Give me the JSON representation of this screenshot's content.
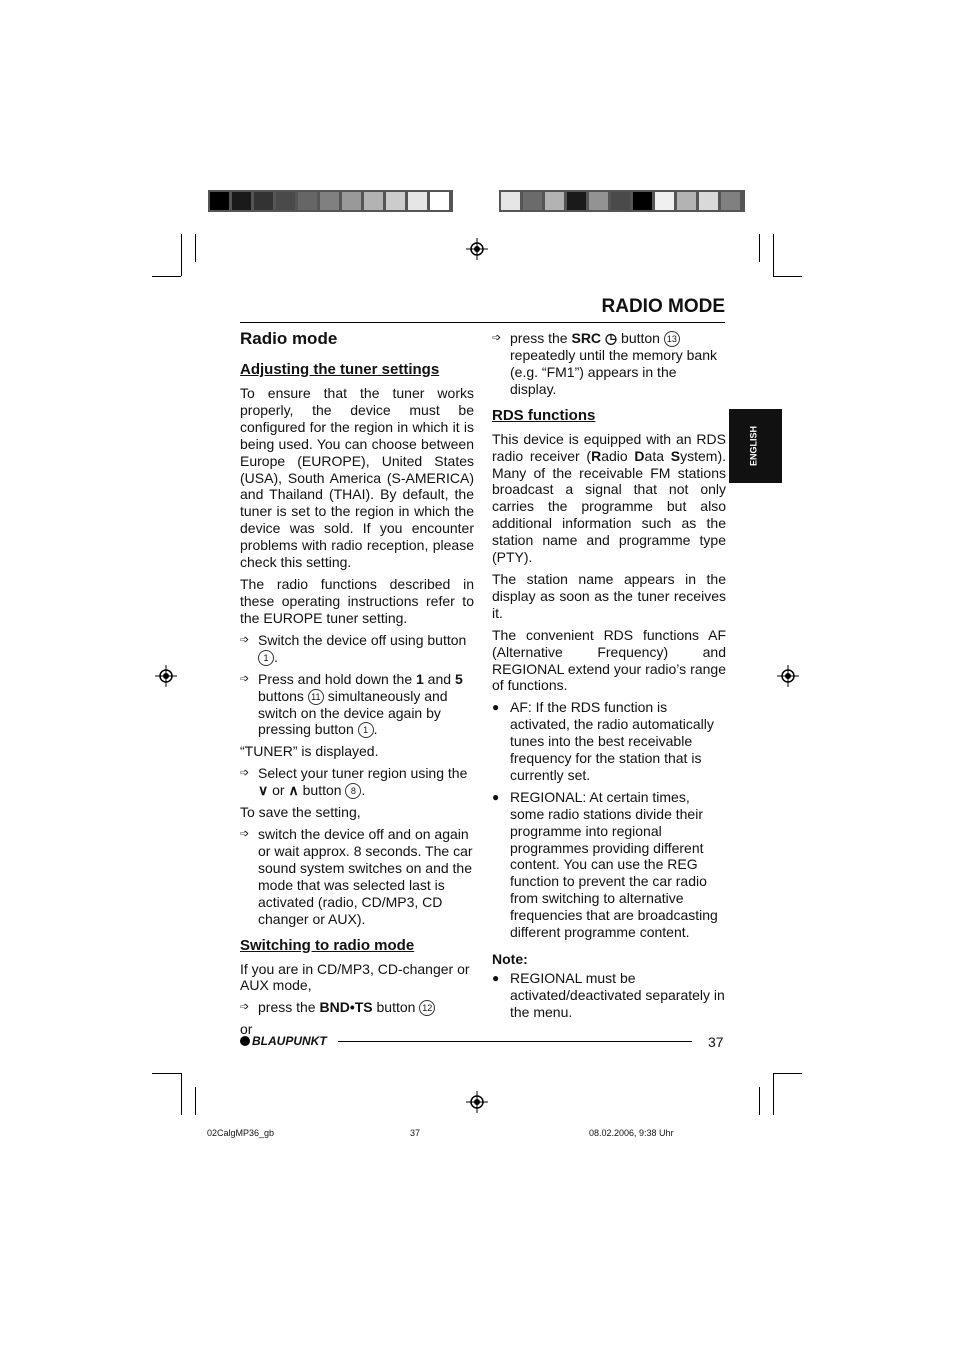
{
  "colors": {
    "bar_left": [
      "#000000",
      "#1a1a1a",
      "#333333",
      "#4a4a4a",
      "#666666",
      "#808080",
      "#999999",
      "#b3b3b3",
      "#cccccc",
      "#e6e6e6",
      "#ffffff"
    ],
    "bar_right": [
      "#e6e6e6",
      "#6b6b6b",
      "#b3b3b3",
      "#1a1a1a",
      "#939393",
      "#4a4a4a",
      "#000000",
      "#f0f0f0",
      "#b3b3b3",
      "#d9d9d9",
      "#808080"
    ]
  },
  "header": {
    "title": "RADIO MODE"
  },
  "side_tab": "ENGLISH",
  "left": [
    {
      "k": "h2",
      "s": [
        {
          "t": "Radio mode"
        }
      ]
    },
    {
      "k": "h3",
      "s": [
        {
          "t": "Adjusting the tuner settings"
        }
      ]
    },
    {
      "k": "p",
      "s": [
        {
          "t": "To ensure that the tuner works properly, the device must be configured for the region in which it is being used. You can choose between Europe (EUROPE), United States (USA), South America (S-AMERICA) and Thailand (THAI). By default, the tuner is set to the region in which the device was sold. If you encounter problems with radio reception, please check this setting."
        }
      ]
    },
    {
      "k": "p",
      "s": [
        {
          "t": "The radio functions described in these operating instructions refer to the EUROPE tuner setting."
        }
      ]
    },
    {
      "k": "arrow",
      "s": [
        {
          "t": "Switch the device off using button "
        },
        {
          "c": "1"
        },
        {
          "t": "."
        }
      ]
    },
    {
      "k": "arrow",
      "s": [
        {
          "t": "Press and hold down the "
        },
        {
          "b": "1"
        },
        {
          "t": " and "
        },
        {
          "b": "5"
        },
        {
          "t": " buttons "
        },
        {
          "c": "11"
        },
        {
          "t": " simultaneously and switch on the device again by pressing button "
        },
        {
          "c": "1"
        },
        {
          "t": "."
        }
      ]
    },
    {
      "k": "np",
      "s": [
        {
          "t": "“TUNER” is displayed."
        }
      ]
    },
    {
      "k": "arrow",
      "s": [
        {
          "t": "Select your tuner region using the "
        },
        {
          "b": "∨"
        },
        {
          "t": " or "
        },
        {
          "b": "∧"
        },
        {
          "t": " button "
        },
        {
          "c": "8"
        },
        {
          "t": "."
        }
      ]
    },
    {
      "k": "np",
      "s": [
        {
          "t": "To save the setting,"
        }
      ]
    },
    {
      "k": "arrow",
      "s": [
        {
          "t": "switch the device off and on again or wait approx. 8 seconds. The car sound system switches on and the mode that was selected last is activated (radio, CD/MP3, CD changer or AUX)."
        }
      ]
    },
    {
      "k": "h3",
      "s": [
        {
          "t": "Switching to radio mode"
        }
      ]
    },
    {
      "k": "np",
      "s": [
        {
          "t": "If you are in CD/MP3, CD-changer or AUX mode,"
        }
      ]
    },
    {
      "k": "arrow",
      "s": [
        {
          "t": "press the "
        },
        {
          "b": "BND•TS"
        },
        {
          "t": " button "
        },
        {
          "c": "12"
        }
      ]
    },
    {
      "k": "np",
      "s": [
        {
          "t": "or"
        }
      ]
    }
  ],
  "right": [
    {
      "k": "arrow",
      "s": [
        {
          "t": "press the "
        },
        {
          "b": "SRC ◷"
        },
        {
          "t": " button "
        },
        {
          "c": "13"
        },
        {
          "t": " repeatedly until the memory bank (e.g. “FM1”) appears in the display."
        }
      ]
    },
    {
      "k": "h3",
      "s": [
        {
          "t": "RDS functions"
        }
      ]
    },
    {
      "k": "p",
      "s": [
        {
          "t": "This device is equipped with an RDS radio receiver ("
        },
        {
          "b": "R"
        },
        {
          "t": "adio "
        },
        {
          "b": "D"
        },
        {
          "t": "ata "
        },
        {
          "b": "S"
        },
        {
          "t": "ystem). Many of the receivable FM stations broadcast a signal that not only carries the programme but also additional information such as the station name and programme type (PTY)."
        }
      ]
    },
    {
      "k": "p",
      "s": [
        {
          "t": "The station name appears in the display as soon as the tuner receives it."
        }
      ]
    },
    {
      "k": "p",
      "s": [
        {
          "t": "The convenient RDS functions AF (Alternative Frequency) and REGIONAL extend your radio’s range of functions."
        }
      ]
    },
    {
      "k": "dot",
      "s": [
        {
          "t": "AF: If the RDS function is activated, the radio automatically tunes into the best receivable frequency for the station that is currently set."
        }
      ]
    },
    {
      "k": "dot",
      "s": [
        {
          "t": "REGIONAL: At certain times, some radio stations divide their programme into regional programmes providing different content. You can use the REG function to prevent the car radio from switching to alternative frequencies that are broadcasting different programme content."
        }
      ]
    },
    {
      "k": "note",
      "s": [
        {
          "t": "Note:"
        }
      ]
    },
    {
      "k": "dot",
      "s": [
        {
          "t": "REGIONAL must be activated/deactivated separately in the menu."
        }
      ]
    }
  ],
  "footer": {
    "brand": "BLAUPUNKT",
    "page": "37"
  },
  "slug": {
    "file": "02CalgMP36_gb",
    "page": "37",
    "date": "08.02.2006, 9:38 Uhr"
  }
}
